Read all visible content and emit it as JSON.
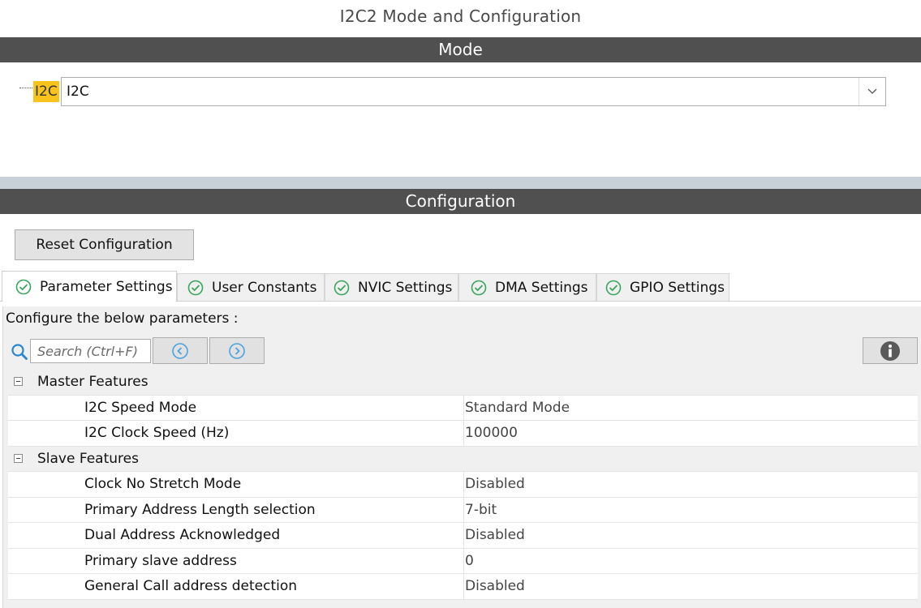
{
  "page_title": "I2C2 Mode and Configuration",
  "mode": {
    "header": "Mode",
    "label": "I2C",
    "selected": "I2C"
  },
  "configuration": {
    "header": "Configuration",
    "reset_button": "Reset Configuration",
    "tabs": [
      {
        "label": "Parameter Settings",
        "active": true
      },
      {
        "label": "User Constants",
        "active": false
      },
      {
        "label": "NVIC Settings",
        "active": false
      },
      {
        "label": "DMA Settings",
        "active": false
      },
      {
        "label": "GPIO Settings",
        "active": false
      }
    ],
    "hint": "Configure the below parameters :",
    "search_placeholder": "Search (Ctrl+F)",
    "groups": [
      {
        "name": "Master Features",
        "params": [
          {
            "name": "I2C Speed Mode",
            "value": "Standard Mode"
          },
          {
            "name": "I2C Clock Speed (Hz)",
            "value": "100000"
          }
        ]
      },
      {
        "name": "Slave Features",
        "params": [
          {
            "name": "Clock No Stretch Mode",
            "value": "Disabled"
          },
          {
            "name": "Primary Address Length selection",
            "value": "7-bit"
          },
          {
            "name": "Dual Address Acknowledged",
            "value": "Disabled"
          },
          {
            "name": "Primary slave address",
            "value": "0"
          },
          {
            "name": "General Call address detection",
            "value": "Disabled"
          }
        ]
      }
    ]
  },
  "icons": {
    "tab_status": "check-circle-icon",
    "search": "search-icon",
    "prev": "circle-left-arrow-icon",
    "next": "circle-right-arrow-icon",
    "info": "info-icon",
    "collapse": "minus-box-icon"
  },
  "colors": {
    "section_bar": "#505050",
    "mode_highlight": "#f7c31c",
    "check_green": "#3aa55c",
    "nav_blue": "#4aa3df"
  }
}
